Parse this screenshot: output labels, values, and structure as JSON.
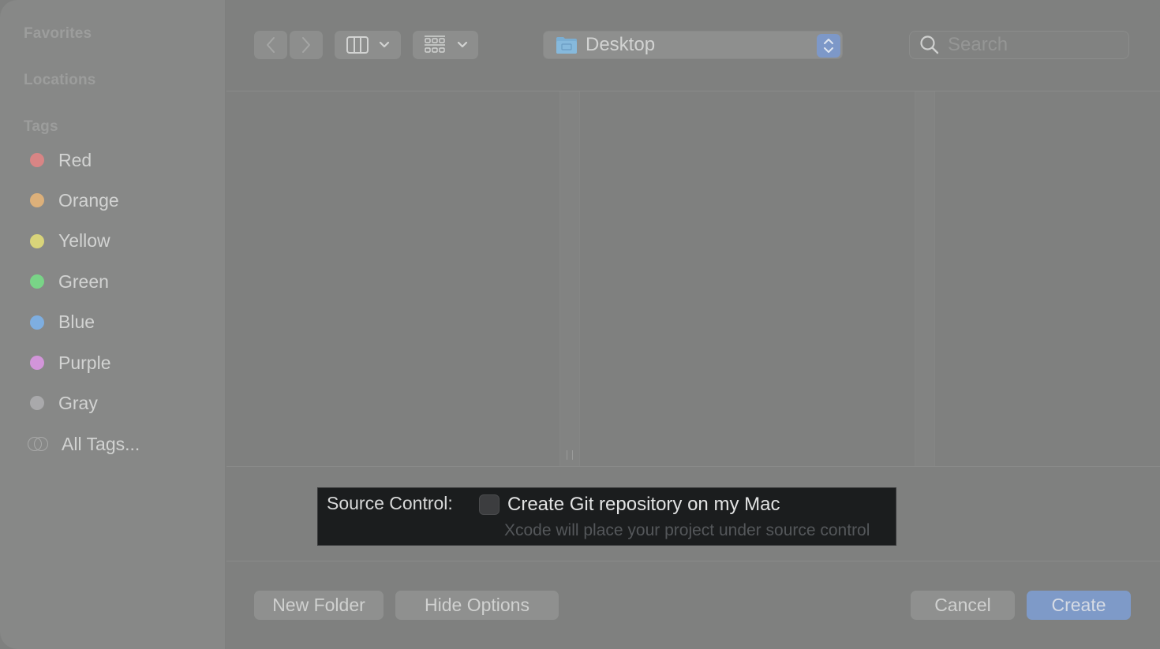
{
  "sidebar": {
    "sections": {
      "favorites": "Favorites",
      "locations": "Locations",
      "tags": "Tags"
    },
    "tags": [
      {
        "label": "Red",
        "color": "#d88585"
      },
      {
        "label": "Orange",
        "color": "#dcb07a"
      },
      {
        "label": "Yellow",
        "color": "#d9d47a"
      },
      {
        "label": "Green",
        "color": "#79d487"
      },
      {
        "label": "Blue",
        "color": "#7eaee0"
      },
      {
        "label": "Purple",
        "color": "#d295d9"
      },
      {
        "label": "Gray",
        "color": "#a9a9ab"
      }
    ],
    "all_tags_label": "All Tags..."
  },
  "toolbar": {
    "back_icon": "chevron-left-icon",
    "forward_icon": "chevron-right-icon",
    "view_mode_icon": "columns-view-icon",
    "group_icon": "grid-group-icon",
    "location": {
      "label": "Desktop",
      "icon": "desktop-folder-icon"
    },
    "search": {
      "placeholder": "Search",
      "value": ""
    }
  },
  "options": {
    "label": "Source Control:",
    "checkbox_label": "Create Git repository on my Mac",
    "checkbox_checked": false,
    "hint": "Xcode will place your project under source control"
  },
  "buttons": {
    "new_folder": "New Folder",
    "hide_options": "Hide Options",
    "cancel": "Cancel",
    "create": "Create"
  },
  "colors": {
    "accent": "#7e9ac8",
    "options_panel": "#1b1d1e"
  }
}
